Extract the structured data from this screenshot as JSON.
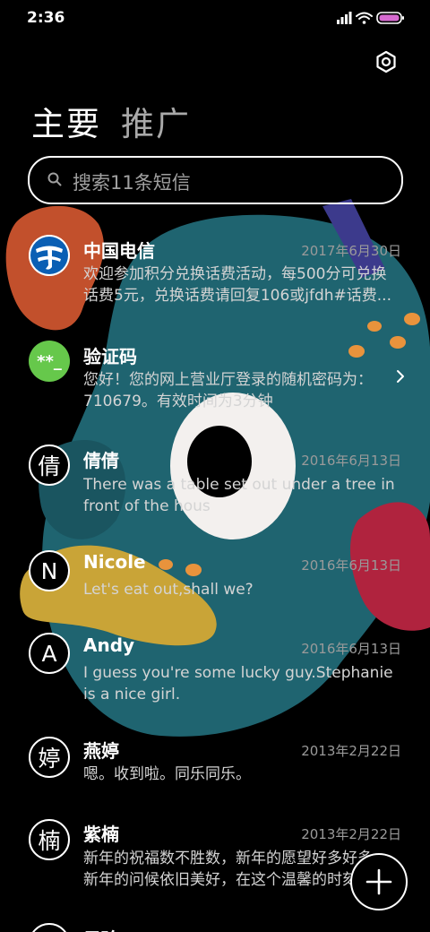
{
  "status_bar": {
    "time": "2:36"
  },
  "tabs": [
    {
      "label": "主要"
    },
    {
      "label": "推广"
    }
  ],
  "search": {
    "placeholder": "搜索11条短信"
  },
  "conversations": [
    {
      "name": "中国电信",
      "date": "2017年6月30日",
      "avatar": "china-telecom-logo",
      "preview": [
        "欢迎参加积分兑换话费活动，每500分可兑换",
        "话费5元，兑换话费请回复106或jfdh#话费..."
      ]
    },
    {
      "name": "验证码",
      "date": "",
      "avatar_text": "**_",
      "preview": [
        "您好！您的网上营业厅登录的随机密码为：",
        "710679。有效时间为3分钟"
      ]
    },
    {
      "name": "倩倩",
      "date": "2016年6月13日",
      "avatar_text": "倩",
      "preview": [
        "There was a table set out under a tree in",
        "front of the hous"
      ]
    },
    {
      "name": "Nicole",
      "date": "2016年6月13日",
      "avatar_text": "N",
      "preview": [
        "Let's eat out,shall we?"
      ]
    },
    {
      "name": "Andy",
      "date": "2016年6月13日",
      "avatar_text": "A",
      "preview": [
        "I guess you're some lucky guy.Stephanie",
        "is a nice girl."
      ]
    },
    {
      "name": "燕婷",
      "date": "2013年2月22日",
      "avatar_text": "婷",
      "preview": [
        "嗯。收到啦。同乐同乐。"
      ]
    },
    {
      "name": "紫楠",
      "date": "2013年2月22日",
      "avatar_text": "楠",
      "preview": [
        "新年的祝福数不胜数，新年的愿望好多好多，",
        "新年的问候依旧美好，在这个温馨的时刻"
      ]
    },
    {
      "name": "子玲",
      "date": "",
      "avatar_text": "",
      "preview": []
    }
  ],
  "icons": {
    "settings": "gear-icon",
    "search": "search-icon",
    "compose": "plus-icon",
    "chevron": "chevron-right-icon"
  },
  "colors": {
    "background": "#000000",
    "avatar_green": "#66c84b",
    "telecom_blue": "#0a5fb4",
    "secondary_text": "#9a9a9a"
  }
}
